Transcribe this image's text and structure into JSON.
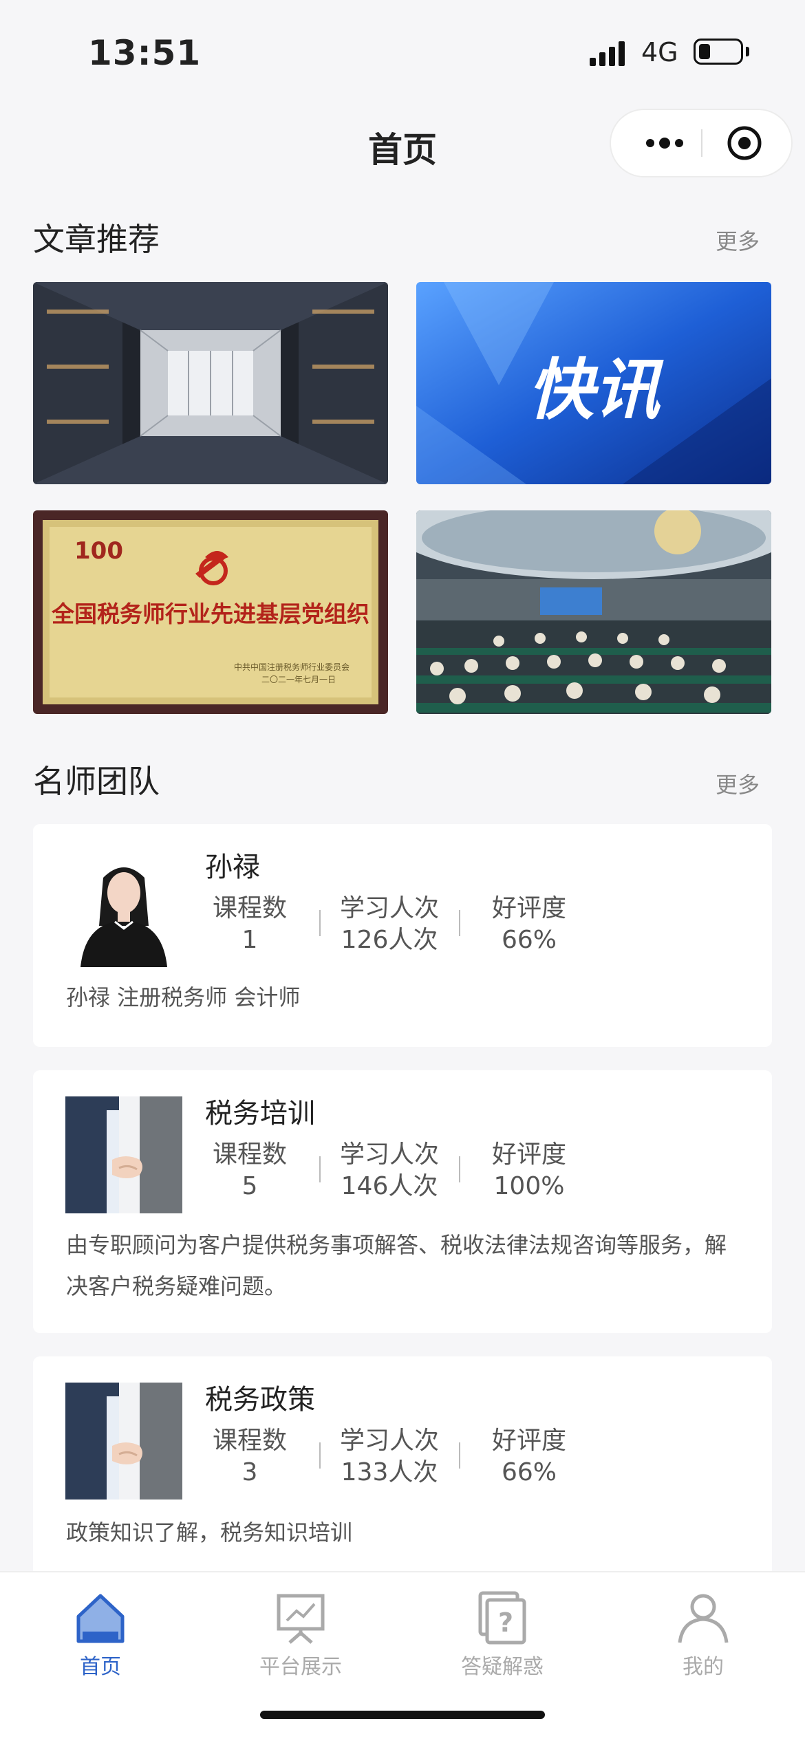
{
  "status_bar": {
    "time": "13:51",
    "network": "4G"
  },
  "nav": {
    "title": "首页"
  },
  "articles": {
    "title": "文章推荐",
    "more": "更多",
    "items": [
      {
        "image": "architecture-atrium-photo"
      },
      {
        "image": "news-flash-banner",
        "text": "快讯"
      },
      {
        "image": "award-plaque-photo",
        "text": "全国税务师行业先进基层党组织",
        "subtext": "中共中国注册税务师行业委员会",
        "date": "二〇二一年七月一日"
      },
      {
        "image": "conference-hall-photo"
      }
    ]
  },
  "teachers": {
    "title": "名师团队",
    "more": "更多",
    "stat_labels": [
      "课程数",
      "学习人次",
      "好评度"
    ],
    "items": [
      {
        "name": "孙禄",
        "avatar": "portrait-photo",
        "courses": "1",
        "learners": "126人次",
        "rating": "66%",
        "desc": "孙禄 注册税务师 会计师"
      },
      {
        "name": "税务培训",
        "avatar": "handshake-photo",
        "courses": "5",
        "learners": "146人次",
        "rating": "100%",
        "desc": "由专职顾问为客户提供税务事项解答、税收法律法规咨询等服务，解决客户税务疑难问题。"
      },
      {
        "name": "税务政策",
        "avatar": "handshake-photo",
        "courses": "3",
        "learners": "133人次",
        "rating": "66%",
        "desc": "政策知识了解，税务知识培训"
      }
    ]
  },
  "tabs": [
    {
      "label": "首页",
      "icon": "home-icon",
      "active": true
    },
    {
      "label": "平台展示",
      "icon": "presentation-icon",
      "active": false
    },
    {
      "label": "答疑解惑",
      "icon": "question-icon",
      "active": false
    },
    {
      "label": "我的",
      "icon": "user-icon",
      "active": false
    }
  ],
  "colors": {
    "accent": "#2d63c8",
    "background": "#f6f6f8",
    "muted": "#aaaaaa"
  }
}
